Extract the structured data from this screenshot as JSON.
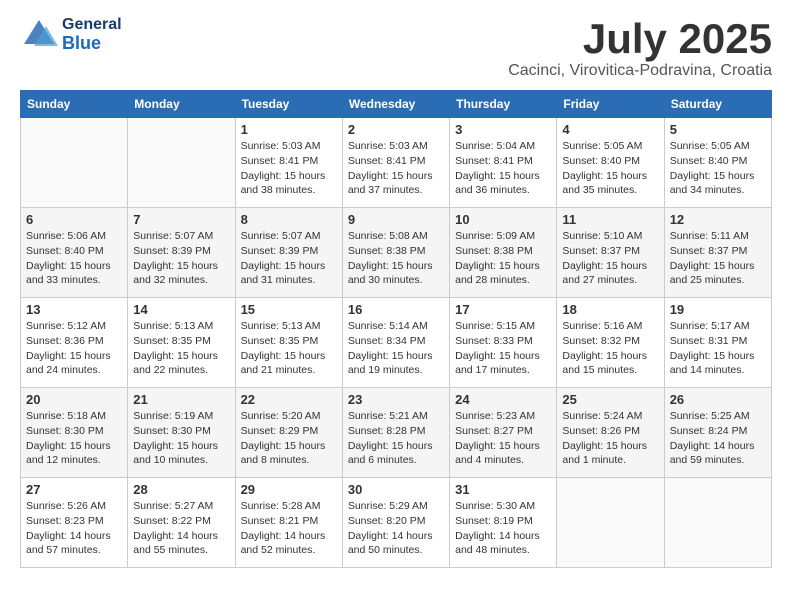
{
  "header": {
    "logo_general": "General",
    "logo_blue": "Blue",
    "month_title": "July 2025",
    "location": "Cacinci, Virovitica-Podravina, Croatia"
  },
  "days_of_week": [
    "Sunday",
    "Monday",
    "Tuesday",
    "Wednesday",
    "Thursday",
    "Friday",
    "Saturday"
  ],
  "weeks": [
    [
      {
        "day": "",
        "info": ""
      },
      {
        "day": "",
        "info": ""
      },
      {
        "day": "1",
        "info": "Sunrise: 5:03 AM\nSunset: 8:41 PM\nDaylight: 15 hours and 38 minutes."
      },
      {
        "day": "2",
        "info": "Sunrise: 5:03 AM\nSunset: 8:41 PM\nDaylight: 15 hours and 37 minutes."
      },
      {
        "day": "3",
        "info": "Sunrise: 5:04 AM\nSunset: 8:41 PM\nDaylight: 15 hours and 36 minutes."
      },
      {
        "day": "4",
        "info": "Sunrise: 5:05 AM\nSunset: 8:40 PM\nDaylight: 15 hours and 35 minutes."
      },
      {
        "day": "5",
        "info": "Sunrise: 5:05 AM\nSunset: 8:40 PM\nDaylight: 15 hours and 34 minutes."
      }
    ],
    [
      {
        "day": "6",
        "info": "Sunrise: 5:06 AM\nSunset: 8:40 PM\nDaylight: 15 hours and 33 minutes."
      },
      {
        "day": "7",
        "info": "Sunrise: 5:07 AM\nSunset: 8:39 PM\nDaylight: 15 hours and 32 minutes."
      },
      {
        "day": "8",
        "info": "Sunrise: 5:07 AM\nSunset: 8:39 PM\nDaylight: 15 hours and 31 minutes."
      },
      {
        "day": "9",
        "info": "Sunrise: 5:08 AM\nSunset: 8:38 PM\nDaylight: 15 hours and 30 minutes."
      },
      {
        "day": "10",
        "info": "Sunrise: 5:09 AM\nSunset: 8:38 PM\nDaylight: 15 hours and 28 minutes."
      },
      {
        "day": "11",
        "info": "Sunrise: 5:10 AM\nSunset: 8:37 PM\nDaylight: 15 hours and 27 minutes."
      },
      {
        "day": "12",
        "info": "Sunrise: 5:11 AM\nSunset: 8:37 PM\nDaylight: 15 hours and 25 minutes."
      }
    ],
    [
      {
        "day": "13",
        "info": "Sunrise: 5:12 AM\nSunset: 8:36 PM\nDaylight: 15 hours and 24 minutes."
      },
      {
        "day": "14",
        "info": "Sunrise: 5:13 AM\nSunset: 8:35 PM\nDaylight: 15 hours and 22 minutes."
      },
      {
        "day": "15",
        "info": "Sunrise: 5:13 AM\nSunset: 8:35 PM\nDaylight: 15 hours and 21 minutes."
      },
      {
        "day": "16",
        "info": "Sunrise: 5:14 AM\nSunset: 8:34 PM\nDaylight: 15 hours and 19 minutes."
      },
      {
        "day": "17",
        "info": "Sunrise: 5:15 AM\nSunset: 8:33 PM\nDaylight: 15 hours and 17 minutes."
      },
      {
        "day": "18",
        "info": "Sunrise: 5:16 AM\nSunset: 8:32 PM\nDaylight: 15 hours and 15 minutes."
      },
      {
        "day": "19",
        "info": "Sunrise: 5:17 AM\nSunset: 8:31 PM\nDaylight: 15 hours and 14 minutes."
      }
    ],
    [
      {
        "day": "20",
        "info": "Sunrise: 5:18 AM\nSunset: 8:30 PM\nDaylight: 15 hours and 12 minutes."
      },
      {
        "day": "21",
        "info": "Sunrise: 5:19 AM\nSunset: 8:30 PM\nDaylight: 15 hours and 10 minutes."
      },
      {
        "day": "22",
        "info": "Sunrise: 5:20 AM\nSunset: 8:29 PM\nDaylight: 15 hours and 8 minutes."
      },
      {
        "day": "23",
        "info": "Sunrise: 5:21 AM\nSunset: 8:28 PM\nDaylight: 15 hours and 6 minutes."
      },
      {
        "day": "24",
        "info": "Sunrise: 5:23 AM\nSunset: 8:27 PM\nDaylight: 15 hours and 4 minutes."
      },
      {
        "day": "25",
        "info": "Sunrise: 5:24 AM\nSunset: 8:26 PM\nDaylight: 15 hours and 1 minute."
      },
      {
        "day": "26",
        "info": "Sunrise: 5:25 AM\nSunset: 8:24 PM\nDaylight: 14 hours and 59 minutes."
      }
    ],
    [
      {
        "day": "27",
        "info": "Sunrise: 5:26 AM\nSunset: 8:23 PM\nDaylight: 14 hours and 57 minutes."
      },
      {
        "day": "28",
        "info": "Sunrise: 5:27 AM\nSunset: 8:22 PM\nDaylight: 14 hours and 55 minutes."
      },
      {
        "day": "29",
        "info": "Sunrise: 5:28 AM\nSunset: 8:21 PM\nDaylight: 14 hours and 52 minutes."
      },
      {
        "day": "30",
        "info": "Sunrise: 5:29 AM\nSunset: 8:20 PM\nDaylight: 14 hours and 50 minutes."
      },
      {
        "day": "31",
        "info": "Sunrise: 5:30 AM\nSunset: 8:19 PM\nDaylight: 14 hours and 48 minutes."
      },
      {
        "day": "",
        "info": ""
      },
      {
        "day": "",
        "info": ""
      }
    ]
  ]
}
